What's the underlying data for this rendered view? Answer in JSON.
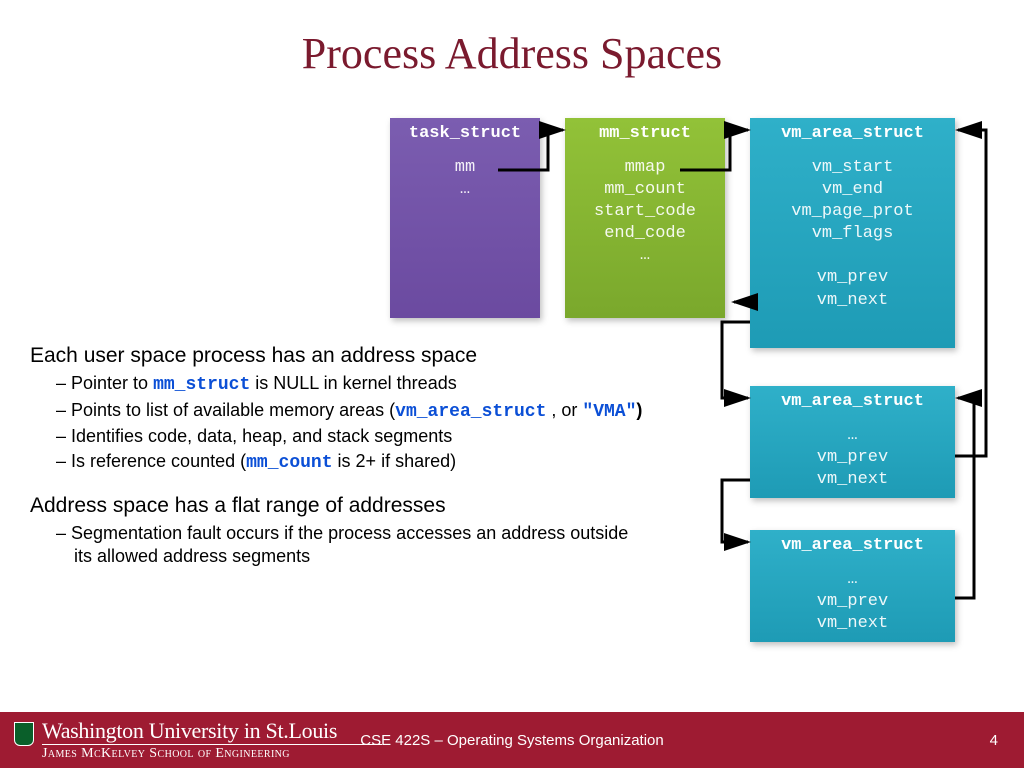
{
  "title": "Process Address Spaces",
  "boxes": {
    "task": {
      "hdr": "task_struct",
      "fields": [
        "mm",
        "…"
      ]
    },
    "mm": {
      "hdr": "mm_struct",
      "fields": [
        "mmap",
        "mm_count",
        "start_code",
        "end_code",
        "…"
      ]
    },
    "vma1": {
      "hdr": "vm_area_struct",
      "fields": [
        "vm_start",
        "vm_end",
        "vm_page_prot",
        "vm_flags",
        "",
        "vm_prev",
        "vm_next"
      ]
    },
    "vma2": {
      "hdr": "vm_area_struct",
      "fields": [
        "…",
        "vm_prev",
        "vm_next"
      ]
    },
    "vma3": {
      "hdr": "vm_area_struct",
      "fields": [
        "…",
        "vm_prev",
        "vm_next"
      ]
    }
  },
  "text": {
    "p1_lead": "Each user space process has an address space",
    "p1_s1_a": "Pointer to ",
    "p1_s1_code": "mm_struct",
    "p1_s1_b": " is NULL in kernel threads",
    "p1_s2_a": "Points to list of available memory areas (",
    "p1_s2_code1": "vm_area_struct",
    "p1_s2_mid": " , or ",
    "p1_s2_code2": "\"VMA\"",
    "p1_s2_b": ")",
    "p1_s3": "Identifies code, data, heap, and stack segments",
    "p1_s4_a": "Is reference counted (",
    "p1_s4_code": "mm_count",
    "p1_s4_b": " is 2+ if shared)",
    "p2_lead": "Address space has a flat range of addresses",
    "p2_s1": "Segmentation fault occurs if the process accesses an address outside its allowed address segments"
  },
  "footer": {
    "univ_main": "Washington University in St.Louis",
    "univ_sub": "James McKelvey School of Engineering",
    "course": "CSE 422S – Operating Systems Organization",
    "page": "4"
  }
}
